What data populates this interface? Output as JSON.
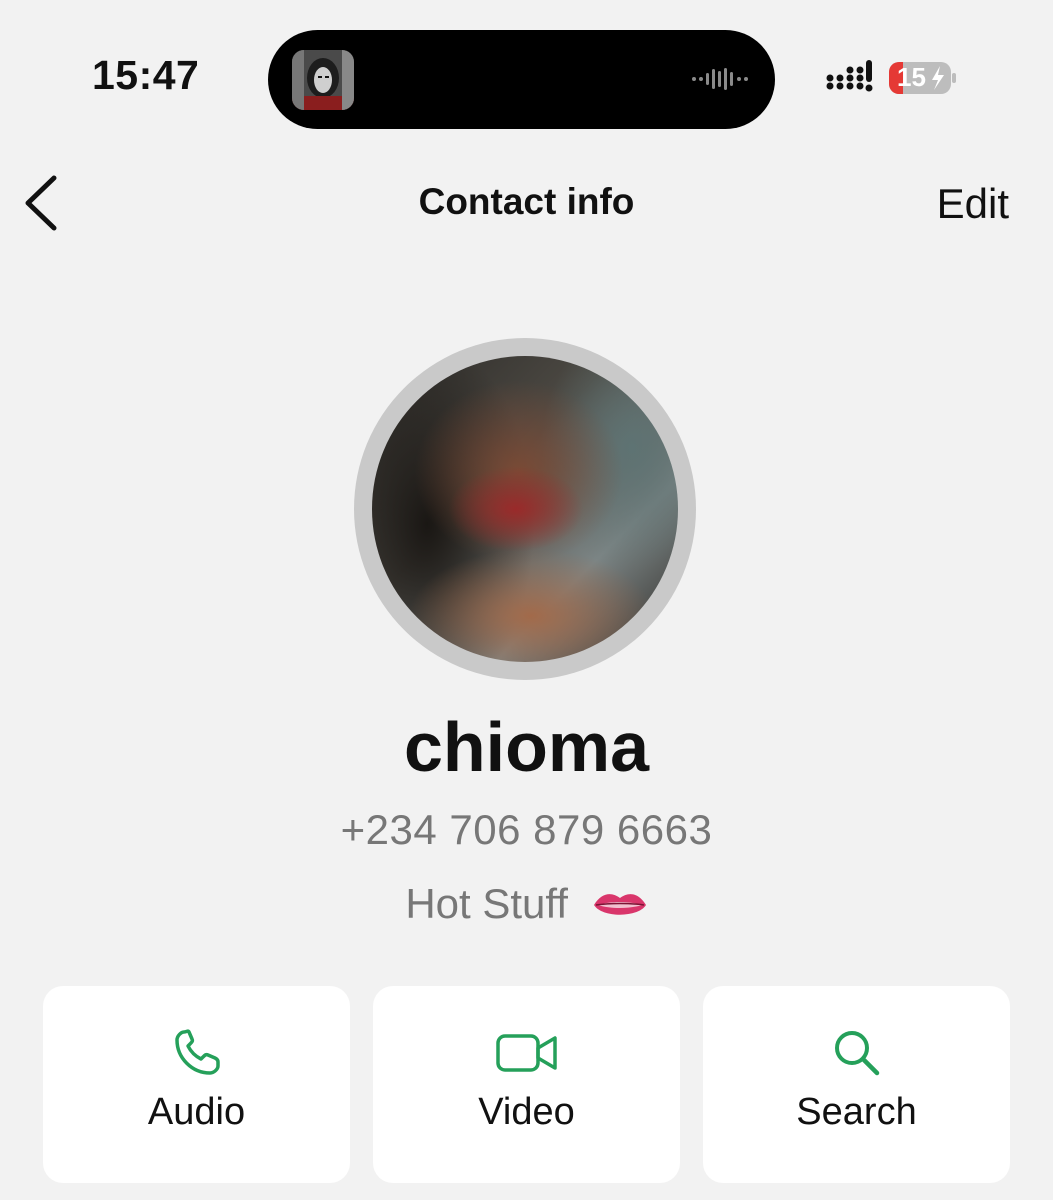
{
  "status_bar": {
    "time": "15:47",
    "battery": "15"
  },
  "nav": {
    "back_icon": "chevron-left-icon",
    "title": "Contact info",
    "edit_label": "Edit"
  },
  "contact": {
    "name": "chioma",
    "phone": "+234 706 879 6663",
    "about": "Hot Stuff",
    "about_emoji": "lips-emoji"
  },
  "actions": [
    {
      "label": "Audio",
      "icon": "phone-icon"
    },
    {
      "label": "Video",
      "icon": "video-camera-icon"
    },
    {
      "label": "Search",
      "icon": "search-icon"
    }
  ],
  "colors": {
    "background": "#f2f2f2",
    "accent_green": "#25a05a",
    "secondary_text": "#777777",
    "battery_low_red": "#e53935"
  }
}
